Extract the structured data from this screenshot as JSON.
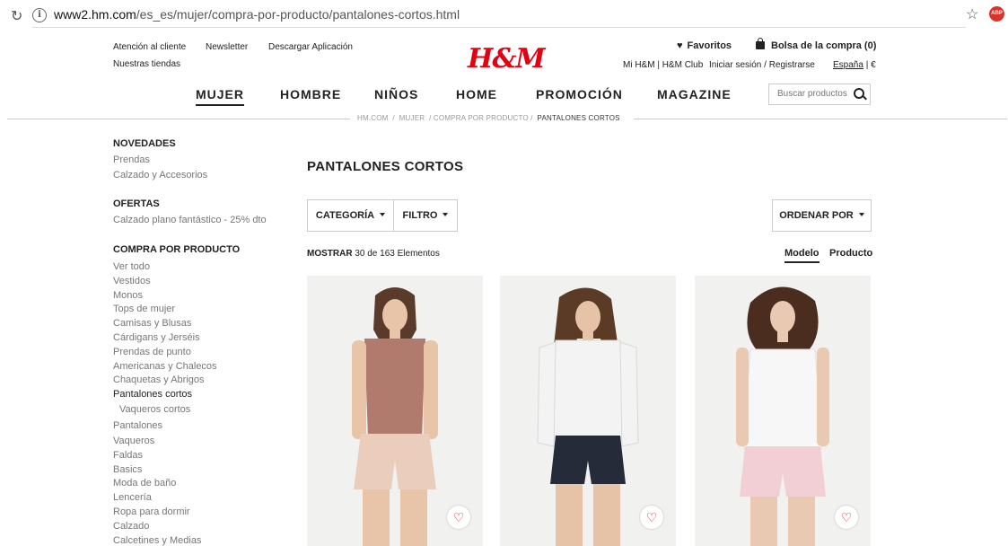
{
  "browser": {
    "url_domain": "www2.hm.com",
    "url_path": "/es_es/mujer/compra-por-producto/pantalones-cortos.html"
  },
  "header": {
    "links_left": [
      "Atención al cliente",
      "Newsletter",
      "Descargar Aplicación"
    ],
    "stores": "Nuestras tiendas",
    "logo": "H&M",
    "favorites": "Favoritos",
    "bag": "Bolsa de la compra (0)",
    "club": "Mi H&M | H&M Club",
    "login": "Iniciar sesión / Registrarse",
    "country": "España",
    "currency": "| €"
  },
  "nav": {
    "items": [
      "MUJER",
      "HOMBRE",
      "NIÑOS",
      "HOME",
      "PROMOCIÓN",
      "MAGAZINE"
    ],
    "active": "MUJER"
  },
  "search": {
    "placeholder": "Buscar productos"
  },
  "breadcrumb": {
    "items": [
      "HM.COM",
      "MUJER",
      "COMPRA POR PRODUCTO"
    ],
    "current": "PANTALONES CORTOS"
  },
  "sidebar": {
    "sections": [
      {
        "title": "NOVEDADES",
        "items": [
          "Prendas",
          "Calzado y Accesorios"
        ]
      },
      {
        "title": "OFERTAS",
        "items": [
          "Calzado plano fantástico - 25% dto"
        ]
      },
      {
        "title": "COMPRA POR PRODUCTO",
        "items": [
          "Ver todo",
          "Vestidos",
          "Monos",
          "Tops de mujer",
          "Camisas y Blusas",
          "Cárdigans y Jerséis",
          "Prendas de punto",
          "Americanas y Chalecos",
          "Chaquetas y Abrigos",
          "Pantalones cortos",
          "Vaqueros cortos",
          "Pantalones",
          "Vaqueros",
          "Faldas",
          "Basics",
          "Moda de baño",
          "Lencería",
          "Ropa para dormir",
          "Calzado",
          "Calcetines y Medias"
        ]
      }
    ],
    "current_item": "Pantalones cortos"
  },
  "main": {
    "title": "PANTALONES CORTOS",
    "filters": {
      "category": "CATEGORÍA",
      "filter": "FILTRO",
      "sort": "ORDENAR POR"
    },
    "count": {
      "label": "MOSTRAR",
      "shown": "30",
      "text": "de 163 Elementos"
    },
    "view": {
      "model": "Modelo",
      "product": "Producto",
      "active": "Modelo"
    }
  },
  "colors": {
    "brand_red": "#e50010",
    "text": "#222222",
    "muted": "#777777"
  },
  "icons": {
    "favorite": "heart-outline-icon",
    "search": "search-icon",
    "bag": "bag-icon"
  }
}
